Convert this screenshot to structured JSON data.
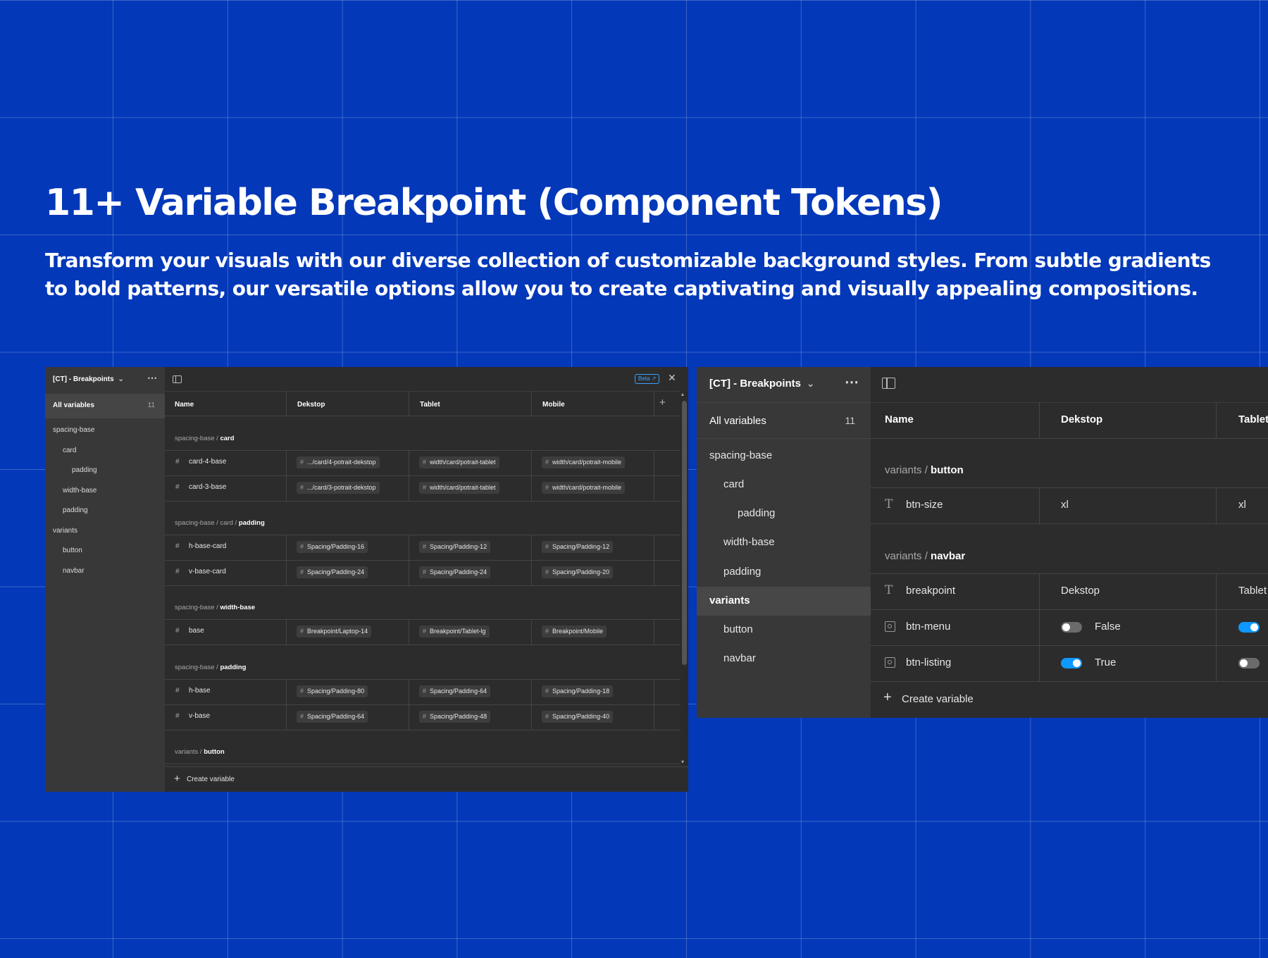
{
  "hero": {
    "title": "11+ Variable Breakpoint (Component Tokens)",
    "description": "Transform your visuals with our diverse collection of customizable background styles. From subtle gradients to bold patterns, our versatile options allow you to create captivating and visually appealing compositions."
  },
  "win_a": {
    "collection": "[CT] - Breakpoints",
    "beta": "Beta",
    "all_variables": "All variables",
    "count": "11",
    "tree": [
      "spacing-base",
      "card",
      "padding",
      "width-base",
      "padding",
      "variants",
      "button",
      "navbar"
    ],
    "columns": [
      "Name",
      "Dekstop",
      "Tablet",
      "Mobile"
    ],
    "groups": [
      {
        "path": "spacing-base / ",
        "name": "card"
      },
      {
        "path": "spacing-base / card / ",
        "name": "padding"
      },
      {
        "path": "spacing-base / ",
        "name": "width-base"
      },
      {
        "path": "spacing-base / ",
        "name": "padding"
      },
      {
        "path": "variants / ",
        "name": "button"
      }
    ],
    "rows": [
      {
        "name": "card-4-base",
        "cells": [
          ".../card/4-potrait-dekstop",
          "width/card/potrait-tablet",
          "width/card/potrait-mobile"
        ]
      },
      {
        "name": "card-3-base",
        "cells": [
          ".../card/3-potrait-dekstop",
          "width/card/potrait-tablet",
          "width/card/potrait-mobile"
        ]
      },
      {
        "name": "h-base-card",
        "cells": [
          "Spacing/Padding-16",
          "Spacing/Padding-12",
          "Spacing/Padding-12"
        ]
      },
      {
        "name": "v-base-card",
        "cells": [
          "Spacing/Padding-24",
          "Spacing/Padding-24",
          "Spacing/Padding-20"
        ]
      },
      {
        "name": "base",
        "cells": [
          "Breakpoint/Laptop-14",
          "Breakpoint/Tablet-lg",
          "Breakpoint/Mobile"
        ]
      },
      {
        "name": "h-base",
        "cells": [
          "Spacing/Padding-80",
          "Spacing/Padding-64",
          "Spacing/Padding-18"
        ]
      },
      {
        "name": "v-base",
        "cells": [
          "Spacing/Padding-64",
          "Spacing/Padding-48",
          "Spacing/Padding-40"
        ]
      }
    ],
    "create_variable": "Create variable"
  },
  "win_b": {
    "collection": "[CT] - Breakpoints",
    "all_variables": "All variables",
    "count": "11",
    "tree": [
      "spacing-base",
      "card",
      "padding",
      "width-base",
      "padding",
      "variants",
      "button",
      "navbar"
    ],
    "columns": [
      "Name",
      "Dekstop",
      "Tablet"
    ],
    "groups": [
      {
        "path": "variants / ",
        "name": "button"
      },
      {
        "path": "variants / ",
        "name": "navbar"
      }
    ],
    "rows": [
      {
        "name": "btn-size",
        "type": "text",
        "desktop": "xl",
        "tablet": "xl"
      },
      {
        "name": "breakpoint",
        "type": "text",
        "desktop": "Dekstop",
        "tablet": "Tablet"
      },
      {
        "name": "btn-menu",
        "type": "boolean",
        "desktop": "False",
        "desktop_on": false,
        "tablet_on": true
      },
      {
        "name": "btn-listing",
        "type": "boolean",
        "desktop": "True",
        "desktop_on": true,
        "tablet_on": false
      }
    ],
    "create_variable": "Create variable"
  },
  "colors": {
    "background": "#0338b9",
    "panel": "#2c2c2c",
    "sidebar": "#383838",
    "accent": "#0d99ff"
  }
}
